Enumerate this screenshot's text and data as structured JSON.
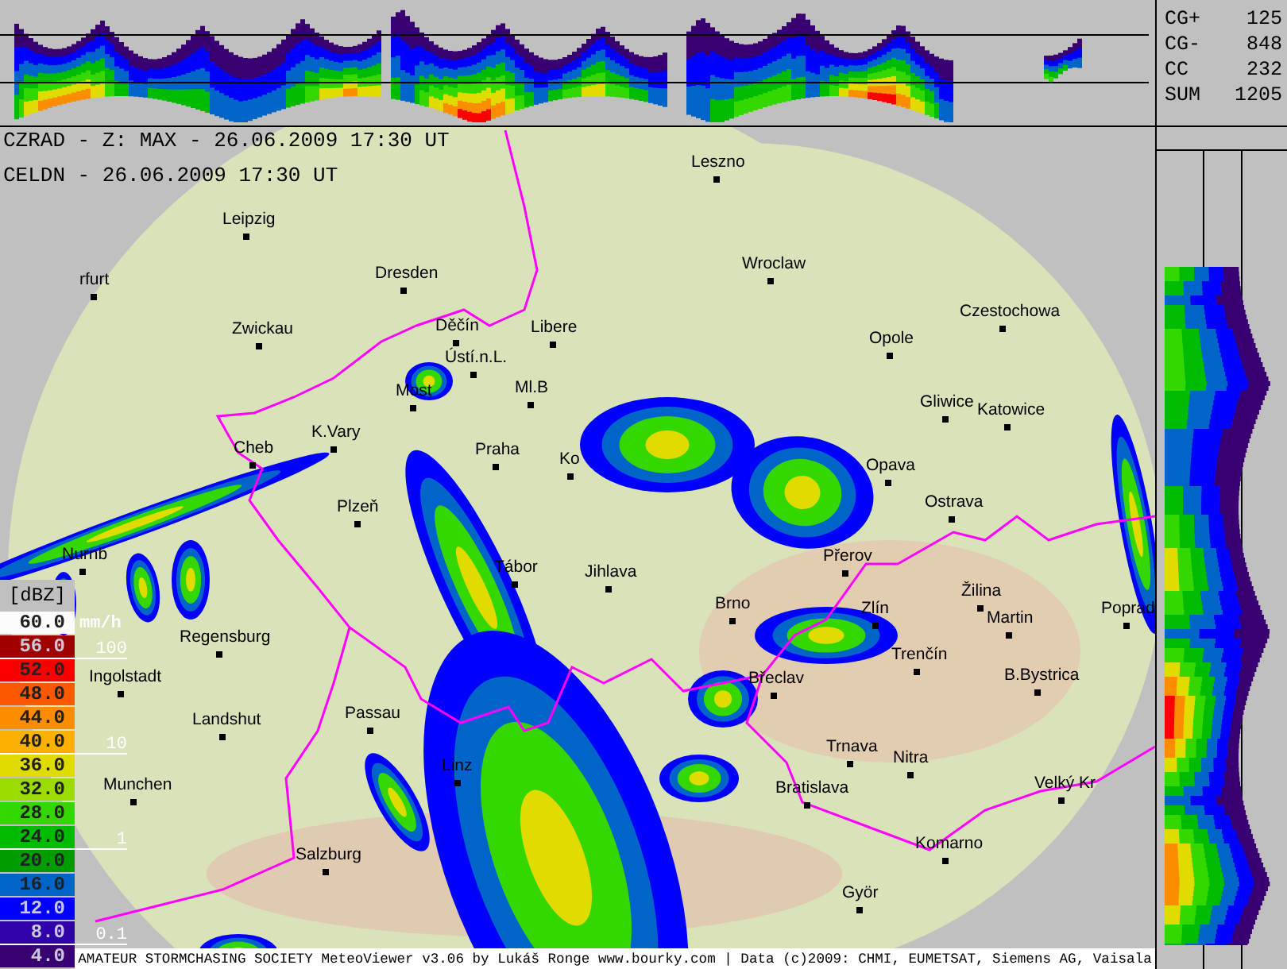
{
  "stats": [
    {
      "label": "CG+",
      "value": "125"
    },
    {
      "label": "CG-",
      "value": "848"
    },
    {
      "label": "CC",
      "value": "232"
    },
    {
      "label": "SUM",
      "value": "1205"
    }
  ],
  "header": {
    "lines": [
      "CZRAD - Z: MAX - 26.06.2009 17:30 UT",
      "CELDN - 26.06.2009 17:30 UT"
    ]
  },
  "map": {
    "cities": [
      {
        "name": "Leszno"
      },
      {
        "name": "Leipzig"
      },
      {
        "name": "rfurt"
      },
      {
        "name": "Dresden"
      },
      {
        "name": "Wroclaw"
      },
      {
        "name": "Czestochowa"
      },
      {
        "name": "Zwickau"
      },
      {
        "name": "Děčín"
      },
      {
        "name": "Libere"
      },
      {
        "name": "Opole"
      },
      {
        "name": "Ústí.n.L."
      },
      {
        "name": "Most"
      },
      {
        "name": "Ml.B"
      },
      {
        "name": "K.Vary"
      },
      {
        "name": "Gliwice"
      },
      {
        "name": "Katowice"
      },
      {
        "name": "Cheb"
      },
      {
        "name": "Praha"
      },
      {
        "name": "Ko"
      },
      {
        "name": "Opava"
      },
      {
        "name": "Ostrava"
      },
      {
        "name": "Plzeň"
      },
      {
        "name": "Přerov"
      },
      {
        "name": "Nurnb"
      },
      {
        "name": "Tábor"
      },
      {
        "name": "Jihlava"
      },
      {
        "name": "Žilina"
      },
      {
        "name": "Brno"
      },
      {
        "name": "Zlín"
      },
      {
        "name": "Poprad"
      },
      {
        "name": "Martin"
      },
      {
        "name": "Regensburg"
      },
      {
        "name": "Trenčín"
      },
      {
        "name": "Ingolstadt"
      },
      {
        "name": "Břeclav"
      },
      {
        "name": "B.Bystrica"
      },
      {
        "name": "Passau"
      },
      {
        "name": "Landshut"
      },
      {
        "name": "Trnava"
      },
      {
        "name": "Nitra"
      },
      {
        "name": "Linz"
      },
      {
        "name": "Munchen"
      },
      {
        "name": "Bratislava"
      },
      {
        "name": "Velký Kr"
      },
      {
        "name": "Komarno"
      },
      {
        "name": "Salzburg"
      },
      {
        "name": "Györ"
      }
    ]
  },
  "legend": {
    "unit": "[dBZ]",
    "rate_unit": "mm/h",
    "levels": [
      {
        "value": "60.0",
        "color": "#fcfcfc"
      },
      {
        "value": "56.0",
        "color": "#a00000",
        "rate": "100"
      },
      {
        "value": "52.0",
        "color": "#fc0000"
      },
      {
        "value": "48.0",
        "color": "#fc5800"
      },
      {
        "value": "44.0",
        "color": "#fc8c00"
      },
      {
        "value": "40.0",
        "color": "#fcb000",
        "rate": "10"
      },
      {
        "value": "36.0",
        "color": "#e0dc00"
      },
      {
        "value": "32.0",
        "color": "#9cdc00"
      },
      {
        "value": "28.0",
        "color": "#34d800"
      },
      {
        "value": "24.0",
        "color": "#00bc00",
        "rate": "1"
      },
      {
        "value": "20.0",
        "color": "#009c00"
      },
      {
        "value": "16.0",
        "color": "#0064c8"
      },
      {
        "value": "12.0",
        "color": "#0000fc"
      },
      {
        "value": "8.0",
        "color": "#3000a8",
        "rate": "0.1"
      },
      {
        "value": "4.0",
        "color": "#380070"
      }
    ]
  },
  "footer": "AMATEUR STORMCHASING SOCIETY MeteoViewer v3.06 by Lukáš Ronge www.bourky.com | Data (c)2009: CHMI, EUMETSAT, Siemens AG, Vaisala"
}
